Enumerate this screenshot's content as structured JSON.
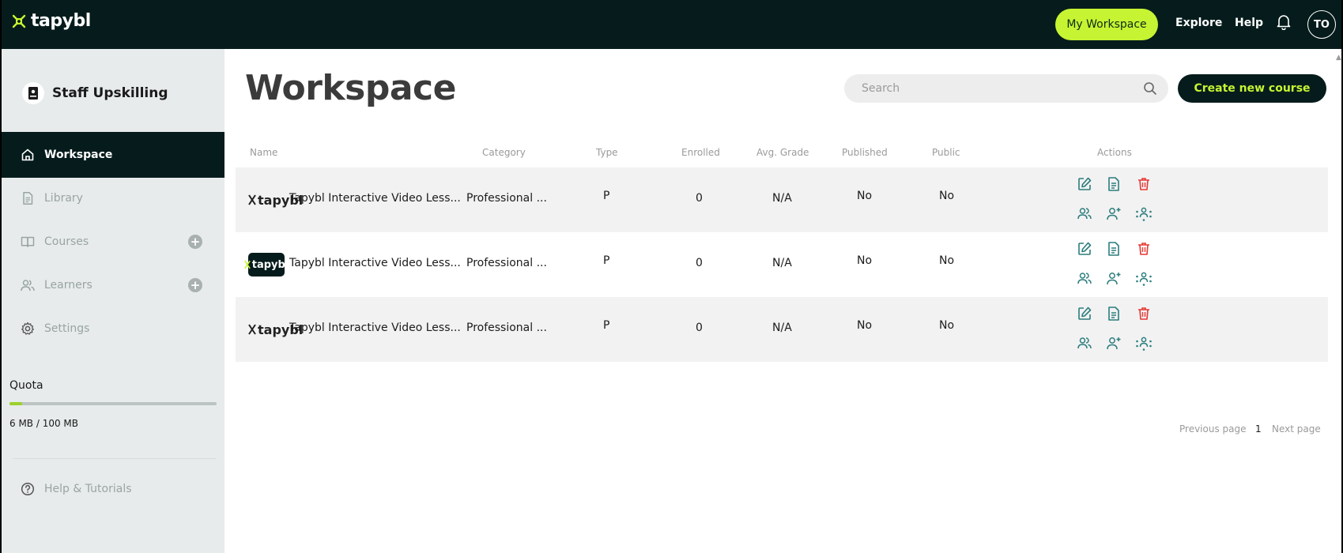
{
  "brand": {
    "name": "tapybl",
    "accent": "#c6f432",
    "dark": "#061c1c"
  },
  "topnav": {
    "my_workspace": "My Workspace",
    "explore": "Explore",
    "help": "Help",
    "avatar_initials": "TO"
  },
  "sidebar": {
    "org_name": "Staff Upskilling",
    "items": [
      {
        "label": "Workspace",
        "icon": "home-icon"
      },
      {
        "label": "Library",
        "icon": "document-icon"
      },
      {
        "label": "Courses",
        "icon": "book-icon"
      },
      {
        "label": "Learners",
        "icon": "users-icon"
      },
      {
        "label": "Settings",
        "icon": "gear-icon"
      }
    ],
    "quota_label": "Quota",
    "quota_text": "6 MB / 100 MB",
    "quota_fraction": 0.06,
    "help_label": "Help & Tutorials"
  },
  "main": {
    "title": "Workspace",
    "search_placeholder": "Search",
    "create_label": "Create new course",
    "columns": [
      "Name",
      "Category",
      "Type",
      "Enrolled",
      "Avg. Grade",
      "Published",
      "Public",
      "Actions"
    ],
    "rows": [
      {
        "name": "Tapybl Interactive Video Less...",
        "category": "Professional ...",
        "type": "P",
        "enrolled": "0",
        "avg_grade": "N/A",
        "published": "No",
        "public": "No",
        "thumb_text": "tapybl"
      },
      {
        "name": "Tapybl Interactive Video Less...",
        "category": "Professional ...",
        "type": "P",
        "enrolled": "0",
        "avg_grade": "N/A",
        "published": "No",
        "public": "No",
        "thumb_text": "tapybl"
      },
      {
        "name": "Tapybl Interactive Video Less...",
        "category": "Professional ...",
        "type": "P",
        "enrolled": "0",
        "avg_grade": "N/A",
        "published": "No",
        "public": "No",
        "thumb_text": "tapybl"
      }
    ],
    "pagination": {
      "previous": "Previous page",
      "current": "1",
      "next": "Next page"
    }
  },
  "colors": {
    "action_teal": "#2d7d7d",
    "action_red": "#e53935",
    "sidebar_bg": "#e7ebeb"
  }
}
